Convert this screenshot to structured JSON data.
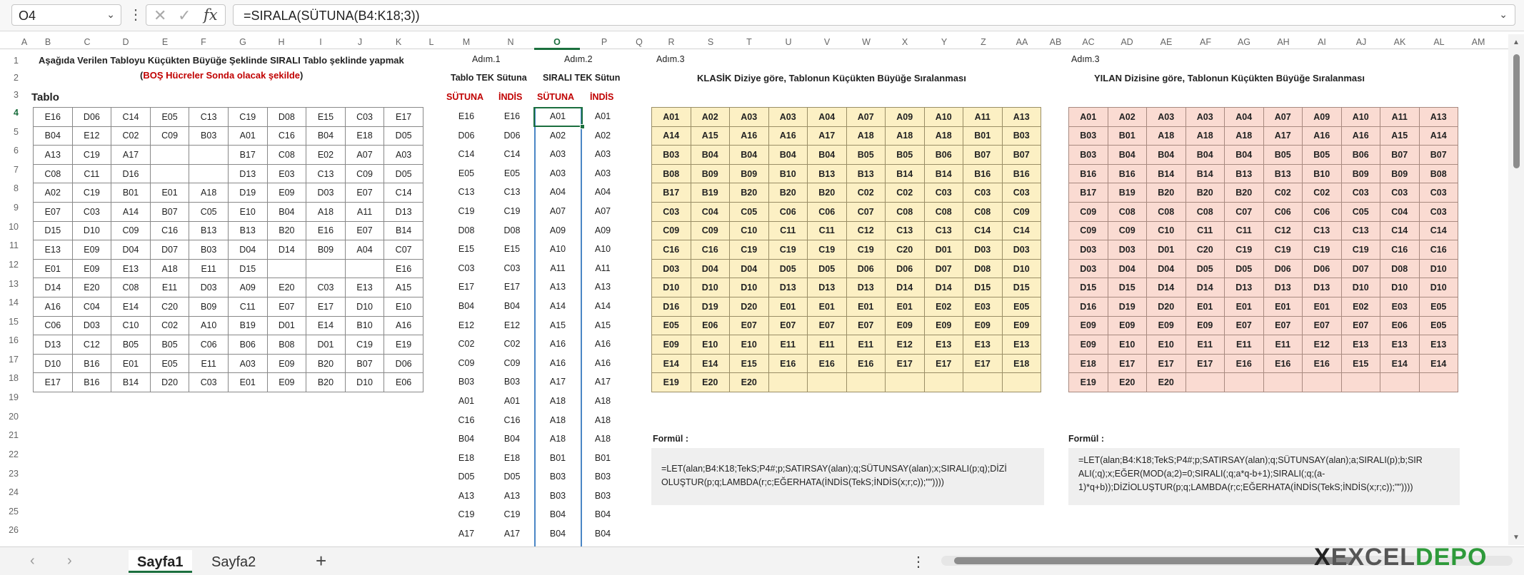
{
  "formula_bar": {
    "cell_ref": "O4",
    "formula": "=SIRALA(SÜTUNA(B4:K18;3))",
    "fx": "fx"
  },
  "columns": [
    "A",
    "B",
    "C",
    "D",
    "E",
    "F",
    "G",
    "H",
    "I",
    "J",
    "K",
    "L",
    "M",
    "N",
    "O",
    "P",
    "Q",
    "R",
    "S",
    "T",
    "U",
    "V",
    "W",
    "X",
    "Y",
    "Z",
    "AA",
    "AB",
    "AC",
    "AD",
    "AE",
    "AF",
    "AG",
    "AH",
    "AI",
    "AJ",
    "AK",
    "AL",
    "AM"
  ],
  "rows": [
    "1",
    "2",
    "3",
    "4",
    "5",
    "6",
    "7",
    "8",
    "9",
    "10",
    "11",
    "12",
    "13",
    "14",
    "15",
    "16",
    "17",
    "18",
    "19",
    "20",
    "21",
    "22",
    "23",
    "24",
    "25",
    "26"
  ],
  "text": {
    "title_line1": "Aşağıda Verilen Tabloyu Küçükten Büyüğe Şeklinde SIRALI Tablo şeklinde yapmak",
    "title_line2_open": "(",
    "title_line2_red": "BOŞ Hücreler Sonda olacak şekilde",
    "title_line2_close": ")",
    "tablo": "Tablo",
    "adim1": "Adım.1",
    "adim2": "Adım.2",
    "adim3a": "Adım.3",
    "adim3b": "Adım.3",
    "tablo_tek": "Tablo TEK Sütuna",
    "sirali_tek": "SIRALI TEK Sütun",
    "sutuna1": "SÜTUNA",
    "indis1": "İNDİS",
    "sutuna2": "SÜTUNA",
    "indis2": "İNDİS",
    "klasik_title": "KLASİK Diziye göre, Tablonun Küçükten Büyüğe Sıralanması",
    "yilan_title": "YILAN Dizisine göre, Tablonun Küçükten Büyüğe Sıralanması",
    "formul1": "Formül :",
    "formul2": "Formül :",
    "formula_klasik_1": "=LET(alan;B4:K18;TekS;P4#;p;SATIRSAY(alan);q;SÜTUNSAY(alan);x;SIRALI(p;q);DİZİ",
    "formula_klasik_2": "OLUŞTUR(p;q;LAMBDA(r;c;EĞERHATA(İNDİS(TekS;İNDİS(x;r;c));\"\"))))",
    "formula_yilan_1": "=LET(alan;B4:K18;TekS;P4#;p;SATIRSAY(alan);q;SÜTUNSAY(alan);a;SIRALI(p);b;SIR",
    "formula_yilan_2": "ALI(;q);x;EĞER(MOD(a;2)=0;SIRALI(;q;a*q-b+1);SIRALI(;q;(a-",
    "formula_yilan_3": "1)*q+b));DİZİOLUŞTUR(p;q;LAMBDA(r;c;EĞERHATA(İNDİS(TekS;İNDİS(x;r;c));\"\"))))"
  },
  "main_table": [
    [
      "E16",
      "D06",
      "C14",
      "E05",
      "C13",
      "C19",
      "D08",
      "E15",
      "C03",
      "E17"
    ],
    [
      "B04",
      "E12",
      "C02",
      "C09",
      "B03",
      "A01",
      "C16",
      "B04",
      "E18",
      "D05"
    ],
    [
      "A13",
      "C19",
      "A17",
      "",
      "",
      "B17",
      "C08",
      "E02",
      "A07",
      "A03"
    ],
    [
      "C08",
      "C11",
      "D16",
      "",
      "",
      "D13",
      "E03",
      "C13",
      "C09",
      "D05"
    ],
    [
      "A02",
      "C19",
      "B01",
      "E01",
      "A18",
      "D19",
      "E09",
      "D03",
      "E07",
      "C14"
    ],
    [
      "E07",
      "C03",
      "A14",
      "B07",
      "C05",
      "E10",
      "B04",
      "A18",
      "A11",
      "D13"
    ],
    [
      "D15",
      "D10",
      "C09",
      "C16",
      "B13",
      "B13",
      "B20",
      "E16",
      "E07",
      "B14"
    ],
    [
      "E13",
      "E09",
      "D04",
      "D07",
      "B03",
      "D04",
      "D14",
      "B09",
      "A04",
      "C07"
    ],
    [
      "E01",
      "E09",
      "E13",
      "A18",
      "E11",
      "D15",
      "",
      "",
      "",
      "E16"
    ],
    [
      "D14",
      "E20",
      "C08",
      "E11",
      "D03",
      "A09",
      "E20",
      "C03",
      "E13",
      "A15"
    ],
    [
      "A16",
      "C04",
      "E14",
      "C20",
      "B09",
      "C11",
      "E07",
      "E17",
      "D10",
      "E10"
    ],
    [
      "C06",
      "D03",
      "C10",
      "C02",
      "A10",
      "B19",
      "D01",
      "E14",
      "B10",
      "A16"
    ],
    [
      "D13",
      "C12",
      "B05",
      "B05",
      "C06",
      "B06",
      "B08",
      "D01",
      "C19",
      "E19"
    ],
    [
      "D10",
      "B16",
      "E01",
      "E05",
      "E11",
      "A03",
      "E09",
      "B20",
      "B07",
      "D06"
    ],
    [
      "E17",
      "B16",
      "B14",
      "D20",
      "C03",
      "E01",
      "E09",
      "B20",
      "D10",
      "E06"
    ]
  ],
  "col_m": [
    "E16",
    "D06",
    "C14",
    "E05",
    "C13",
    "C19",
    "D08",
    "E15",
    "C03",
    "E17",
    "B04",
    "E12",
    "C02",
    "C09",
    "B03",
    "A01",
    "C16",
    "B04",
    "E18",
    "D05",
    "A13",
    "C19",
    "A17"
  ],
  "col_n": [
    "E16",
    "D06",
    "C14",
    "E05",
    "C13",
    "C19",
    "D08",
    "E15",
    "C03",
    "E17",
    "B04",
    "E12",
    "C02",
    "C09",
    "B03",
    "A01",
    "C16",
    "B04",
    "E18",
    "D05",
    "A13",
    "C19",
    "A17"
  ],
  "col_o": [
    "A01",
    "A02",
    "A03",
    "A03",
    "A04",
    "A07",
    "A09",
    "A10",
    "A11",
    "A13",
    "A14",
    "A15",
    "A16",
    "A16",
    "A17",
    "A18",
    "A18",
    "A18",
    "B01",
    "B03",
    "B03",
    "B04",
    "B04"
  ],
  "col_p": [
    "A01",
    "A02",
    "A03",
    "A03",
    "A04",
    "A07",
    "A09",
    "A10",
    "A11",
    "A13",
    "A14",
    "A15",
    "A16",
    "A16",
    "A17",
    "A18",
    "A18",
    "A18",
    "B01",
    "B03",
    "B03",
    "B04",
    "B04"
  ],
  "klasik": [
    [
      "A01",
      "A02",
      "A03",
      "A03",
      "A04",
      "A07",
      "A09",
      "A10",
      "A11",
      "A13"
    ],
    [
      "A14",
      "A15",
      "A16",
      "A16",
      "A17",
      "A18",
      "A18",
      "A18",
      "B01",
      "B03"
    ],
    [
      "B03",
      "B04",
      "B04",
      "B04",
      "B04",
      "B05",
      "B05",
      "B06",
      "B07",
      "B07"
    ],
    [
      "B08",
      "B09",
      "B09",
      "B10",
      "B13",
      "B13",
      "B14",
      "B14",
      "B16",
      "B16"
    ],
    [
      "B17",
      "B19",
      "B20",
      "B20",
      "B20",
      "C02",
      "C02",
      "C03",
      "C03",
      "C03"
    ],
    [
      "C03",
      "C04",
      "C05",
      "C06",
      "C06",
      "C07",
      "C08",
      "C08",
      "C08",
      "C09"
    ],
    [
      "C09",
      "C09",
      "C10",
      "C11",
      "C11",
      "C12",
      "C13",
      "C13",
      "C14",
      "C14"
    ],
    [
      "C16",
      "C16",
      "C19",
      "C19",
      "C19",
      "C19",
      "C20",
      "D01",
      "D03",
      "D03"
    ],
    [
      "D03",
      "D04",
      "D04",
      "D05",
      "D05",
      "D06",
      "D06",
      "D07",
      "D08",
      "D10"
    ],
    [
      "D10",
      "D10",
      "D10",
      "D13",
      "D13",
      "D13",
      "D14",
      "D14",
      "D15",
      "D15"
    ],
    [
      "D16",
      "D19",
      "D20",
      "E01",
      "E01",
      "E01",
      "E01",
      "E02",
      "E03",
      "E05"
    ],
    [
      "E05",
      "E06",
      "E07",
      "E07",
      "E07",
      "E07",
      "E09",
      "E09",
      "E09",
      "E09"
    ],
    [
      "E09",
      "E10",
      "E10",
      "E11",
      "E11",
      "E11",
      "E12",
      "E13",
      "E13",
      "E13"
    ],
    [
      "E14",
      "E14",
      "E15",
      "E16",
      "E16",
      "E16",
      "E17",
      "E17",
      "E17",
      "E18"
    ],
    [
      "E19",
      "E20",
      "E20",
      "",
      "",
      "",
      "",
      "",
      "",
      ""
    ]
  ],
  "yilan": [
    [
      "A01",
      "A02",
      "A03",
      "A03",
      "A04",
      "A07",
      "A09",
      "A10",
      "A11",
      "A13"
    ],
    [
      "B03",
      "B01",
      "A18",
      "A18",
      "A18",
      "A17",
      "A16",
      "A16",
      "A15",
      "A14"
    ],
    [
      "B03",
      "B04",
      "B04",
      "B04",
      "B04",
      "B05",
      "B05",
      "B06",
      "B07",
      "B07"
    ],
    [
      "B16",
      "B16",
      "B14",
      "B14",
      "B13",
      "B13",
      "B10",
      "B09",
      "B09",
      "B08"
    ],
    [
      "B17",
      "B19",
      "B20",
      "B20",
      "B20",
      "C02",
      "C02",
      "C03",
      "C03",
      "C03"
    ],
    [
      "C09",
      "C08",
      "C08",
      "C08",
      "C07",
      "C06",
      "C06",
      "C05",
      "C04",
      "C03"
    ],
    [
      "C09",
      "C09",
      "C10",
      "C11",
      "C11",
      "C12",
      "C13",
      "C13",
      "C14",
      "C14"
    ],
    [
      "D03",
      "D03",
      "D01",
      "C20",
      "C19",
      "C19",
      "C19",
      "C19",
      "C16",
      "C16"
    ],
    [
      "D03",
      "D04",
      "D04",
      "D05",
      "D05",
      "D06",
      "D06",
      "D07",
      "D08",
      "D10"
    ],
    [
      "D15",
      "D15",
      "D14",
      "D14",
      "D13",
      "D13",
      "D13",
      "D10",
      "D10",
      "D10"
    ],
    [
      "D16",
      "D19",
      "D20",
      "E01",
      "E01",
      "E01",
      "E01",
      "E02",
      "E03",
      "E05"
    ],
    [
      "E09",
      "E09",
      "E09",
      "E09",
      "E07",
      "E07",
      "E07",
      "E07",
      "E06",
      "E05"
    ],
    [
      "E09",
      "E10",
      "E10",
      "E11",
      "E11",
      "E11",
      "E12",
      "E13",
      "E13",
      "E13"
    ],
    [
      "E18",
      "E17",
      "E17",
      "E17",
      "E16",
      "E16",
      "E16",
      "E15",
      "E14",
      "E14"
    ],
    [
      "E19",
      "E20",
      "E20",
      "",
      "",
      "",
      "",
      "",
      "",
      ""
    ]
  ],
  "sheets": {
    "tab1": "Sayfa1",
    "tab2": "Sayfa2",
    "add": "+",
    "more": "⋮"
  },
  "logo": {
    "x": "X",
    "text": "EXCEL",
    "depo": "DEPO"
  },
  "colors": {
    "accent": "#1b6f3e",
    "red": "#c00000",
    "yellow": "#fcf0c4",
    "pink": "#fadbd2"
  }
}
